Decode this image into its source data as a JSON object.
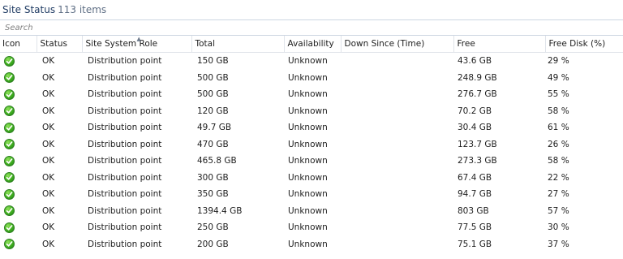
{
  "header": {
    "title": "Site Status",
    "count": "113 items"
  },
  "search": {
    "placeholder": "Search"
  },
  "table": {
    "columns": [
      "Icon",
      "Status",
      "Site System Role",
      "Total",
      "Availability",
      "Down Since (Time)",
      "Free",
      "Free Disk (%)"
    ],
    "sorted_column": "Site System Role",
    "rows": [
      {
        "icon": "ok-check-icon",
        "status": "OK",
        "role": "Distribution point",
        "total": "150 GB",
        "availability": "Unknown",
        "down_since": "",
        "free": "43.6 GB",
        "free_pct": "29 %"
      },
      {
        "icon": "ok-check-icon",
        "status": "OK",
        "role": "Distribution point",
        "total": "500 GB",
        "availability": "Unknown",
        "down_since": "",
        "free": "248.9 GB",
        "free_pct": "49 %"
      },
      {
        "icon": "ok-check-icon",
        "status": "OK",
        "role": "Distribution point",
        "total": "500 GB",
        "availability": "Unknown",
        "down_since": "",
        "free": "276.7 GB",
        "free_pct": "55 %"
      },
      {
        "icon": "ok-check-icon",
        "status": "OK",
        "role": "Distribution point",
        "total": "120 GB",
        "availability": "Unknown",
        "down_since": "",
        "free": "70.2 GB",
        "free_pct": "58 %"
      },
      {
        "icon": "ok-check-icon",
        "status": "OK",
        "role": "Distribution point",
        "total": "49.7 GB",
        "availability": "Unknown",
        "down_since": "",
        "free": "30.4 GB",
        "free_pct": "61 %"
      },
      {
        "icon": "ok-check-icon",
        "status": "OK",
        "role": "Distribution point",
        "total": "470 GB",
        "availability": "Unknown",
        "down_since": "",
        "free": "123.7 GB",
        "free_pct": "26 %"
      },
      {
        "icon": "ok-check-icon",
        "status": "OK",
        "role": "Distribution point",
        "total": "465.8 GB",
        "availability": "Unknown",
        "down_since": "",
        "free": "273.3 GB",
        "free_pct": "58 %"
      },
      {
        "icon": "ok-check-icon",
        "status": "OK",
        "role": "Distribution point",
        "total": "300 GB",
        "availability": "Unknown",
        "down_since": "",
        "free": "67.4 GB",
        "free_pct": "22 %"
      },
      {
        "icon": "ok-check-icon",
        "status": "OK",
        "role": "Distribution point",
        "total": "350 GB",
        "availability": "Unknown",
        "down_since": "",
        "free": "94.7 GB",
        "free_pct": "27 %"
      },
      {
        "icon": "ok-check-icon",
        "status": "OK",
        "role": "Distribution point",
        "total": "1394.4 GB",
        "availability": "Unknown",
        "down_since": "",
        "free": "803 GB",
        "free_pct": "57 %"
      },
      {
        "icon": "ok-check-icon",
        "status": "OK",
        "role": "Distribution point",
        "total": "250 GB",
        "availability": "Unknown",
        "down_since": "",
        "free": "77.5 GB",
        "free_pct": "30 %"
      },
      {
        "icon": "ok-check-icon",
        "status": "OK",
        "role": "Distribution point",
        "total": "200 GB",
        "availability": "Unknown",
        "down_since": "",
        "free": "75.1 GB",
        "free_pct": "37 %"
      }
    ]
  },
  "colors": {
    "title": "#1f3b63",
    "ok_green": "#3fae1f",
    "grid_line": "#e0e4ea"
  }
}
